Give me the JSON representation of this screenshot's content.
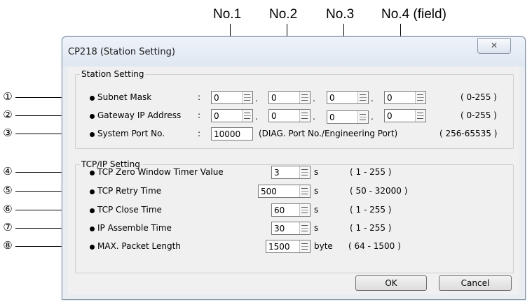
{
  "column_headers": [
    "No.1",
    "No.2",
    "No.3",
    "No.4 (field)"
  ],
  "dialog": {
    "title": "CP218 (Station Setting)",
    "close_label": "✕",
    "ok_label": "OK",
    "cancel_label": "Cancel"
  },
  "station_setting": {
    "legend": "Station Setting",
    "subnet": {
      "callout": "①",
      "label": "Subnet Mask",
      "sep": ":",
      "octets": [
        "0",
        "0",
        "0",
        "0"
      ],
      "range": "( 0-255 )"
    },
    "gateway": {
      "callout": "②",
      "label": "Gateway IP Address",
      "sep": ":",
      "octets": [
        "0",
        "0",
        "0",
        "0"
      ],
      "range": "( 0-255 )"
    },
    "port": {
      "callout": "③",
      "label": "System Port No.",
      "sep": ":",
      "value": "10000",
      "note": "(DIAG. Port No./Engineering Port)",
      "range": "( 256-65535 )"
    }
  },
  "tcpip_setting": {
    "legend": "TCP/IP Setting",
    "rows": [
      {
        "callout": "④",
        "label": "TCP Zero Window Timer Value",
        "value": "3",
        "unit": "s",
        "range": "( 1 - 255 )"
      },
      {
        "callout": "⑤",
        "label": "TCP Retry Time",
        "value": "500",
        "unit": "s",
        "range": "( 50 - 32000 )"
      },
      {
        "callout": "⑥",
        "label": "TCP Close Time",
        "value": "60",
        "unit": "s",
        "range": "( 1 - 255 )"
      },
      {
        "callout": "⑦",
        "label": "IP  Assemble Time",
        "value": "30",
        "unit": "s",
        "range": "( 1 - 255 )"
      },
      {
        "callout": "⑧",
        "label": "MAX. Packet Length",
        "value": "1500",
        "unit": "byte",
        "range": "( 64 - 1500 )"
      }
    ]
  },
  "octet_separator": "."
}
